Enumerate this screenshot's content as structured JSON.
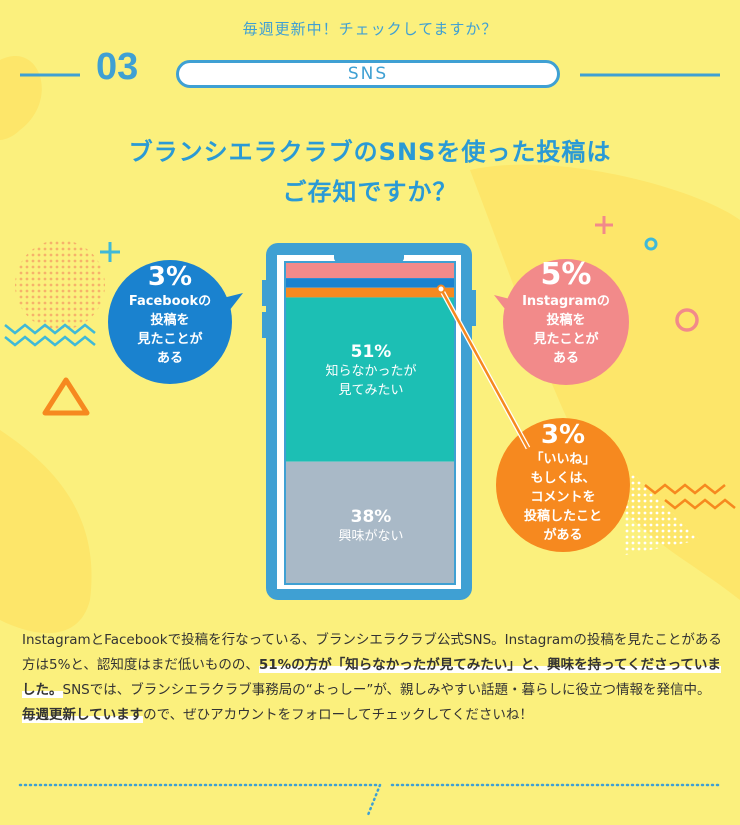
{
  "header": {
    "kicker": "毎週更新中！チェックしてますか？",
    "number": "03",
    "section_label": "SNS"
  },
  "question": {
    "line1": "ブランシエラクラブのSNSを使った投稿は",
    "line2": "ご存知ですか？"
  },
  "results": {
    "facebook": {
      "pct": "3%",
      "lines": [
        "Facebookの",
        "投稿を",
        "見たことが",
        "ある"
      ],
      "value": 3,
      "color": "#1a82cf"
    },
    "instagram": {
      "pct": "5%",
      "lines": [
        "Instagramの",
        "投稿を",
        "見たことが",
        "ある"
      ],
      "value": 5,
      "color": "#f28a8a"
    },
    "posted": {
      "pct": "3%",
      "lines": [
        "「いいね」",
        "もしくは、",
        "コメントを",
        "投稿したこと",
        "がある"
      ],
      "value": 3,
      "color": "#f6891f"
    },
    "want_to_see": {
      "pct": "51%",
      "lines": [
        "知らなかったが",
        "見てみたい"
      ],
      "value": 51,
      "color": "#1cbfb4"
    },
    "not_interested": {
      "pct": "38%",
      "lines": [
        "興味がない"
      ],
      "value": 38,
      "color": "#a9b9c7"
    }
  },
  "body": {
    "p1": "InstagramとFacebookで投稿を行なっている、ブランシエラクラブ公式SNS。Instagramの投稿を見たことがある方は5%と、認知度はまだ低いものの、",
    "b1": "51%の方が「知らなかったが見てみたい」と、興味を持ってくださっていました。",
    "p2": "SNSでは、ブランシエラクラブ事務局の“よっしー”が、親しみやすい話題・暮らしに役立つ情報を発信中。",
    "b2": "毎週更新しています",
    "p3": "ので、ぜひアカウントをフォローしてチェックしてくださいね！"
  }
}
